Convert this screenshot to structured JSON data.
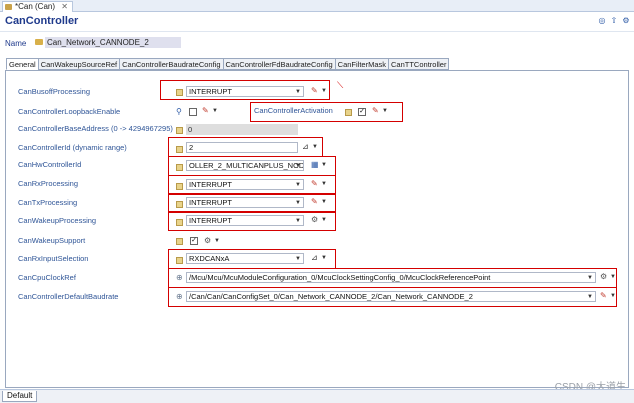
{
  "window_tab": {
    "label": "*Can (Can)",
    "close": "✕"
  },
  "header": {
    "title": "CanController"
  },
  "name_field": {
    "label": "Name",
    "value": "Can_Network_CANNODE_2"
  },
  "tabs": [
    "General",
    "CanWakeupSourceRef",
    "CanControllerBaudrateConfig",
    "CanControllerFdBaudrateConfig",
    "CanFilterMask",
    "CanTTController"
  ],
  "params": {
    "busoff": {
      "label": "CanBusoffProcessing",
      "value": "INTERRUPT"
    },
    "loopback": {
      "label": "CanControllerLoopbackEnable"
    },
    "activation": {
      "label": "CanControllerActivation"
    },
    "base_address": {
      "label": "CanControllerBaseAddress (0 -> 4294967295)",
      "value": "0"
    },
    "controller_id": {
      "label": "CanControllerId (dynamic range)",
      "value": "2"
    },
    "hw_controller": {
      "label": "CanHwControllerId",
      "value": "OLLER_2_MULTICANPLUS_NODE2"
    },
    "rx_processing": {
      "label": "CanRxProcessing",
      "value": "INTERRUPT"
    },
    "tx_processing": {
      "label": "CanTxProcessing",
      "value": "INTERRUPT"
    },
    "wakeup_processing": {
      "label": "CanWakeupProcessing",
      "value": "INTERRUPT"
    },
    "wakeup_support": {
      "label": "CanWakeupSupport"
    },
    "rx_input": {
      "label": "CanRxInputSelection",
      "value": "RXDCANxA"
    },
    "cpu_clock": {
      "label": "CanCpuClockRef",
      "value": "/Mcu/Mcu/McuModuleConfiguration_0/McuClockSettingConfig_0/McuClockReferencePoint"
    },
    "default_baudrate": {
      "label": "CanControllerDefaultBaudrate",
      "value": "/Can/Can/CanConfigSet_0/Can_Network_CANNODE_2/Can_Network_CANNODE_2"
    }
  },
  "bottom_tab": "Default",
  "watermark": "CSDN @大道生",
  "colors": {
    "highlight_box": "#d40000",
    "label_blue": "#2f5597"
  }
}
